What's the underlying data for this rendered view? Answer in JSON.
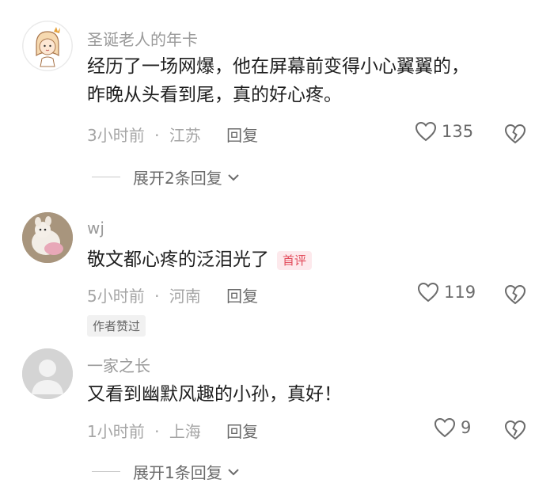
{
  "comments": [
    {
      "username": "圣诞老人的年卡",
      "text_lines": [
        "经历了一场网爆，他在屏幕前变得小心翼翼的，",
        "昨晚从头看到尾，真的好心疼。"
      ],
      "time": "3小时前",
      "location": "江苏",
      "reply_label": "回复",
      "likes": "135",
      "expand_label": "展开2条回复"
    },
    {
      "username": "wj",
      "text": "敬文都心疼的泛泪光了",
      "badge": "首评",
      "time": "5小时前",
      "location": "河南",
      "reply_label": "回复",
      "likes": "119",
      "author_liked": "作者赞过"
    },
    {
      "username": "一家之长",
      "text": "又看到幽默风趣的小孙，真好！",
      "time": "1小时前",
      "location": "上海",
      "reply_label": "回复",
      "likes": "9",
      "expand_label": "展开1条回复"
    }
  ],
  "meta_separator": "·",
  "icons": {
    "like": "heart-outline-icon",
    "dislike": "broken-heart-icon",
    "expand": "chevron-down-icon"
  },
  "colors": {
    "badge_text": "#e24a5a",
    "badge_bg": "#fde9ec",
    "muted": "#a5a5a5"
  }
}
